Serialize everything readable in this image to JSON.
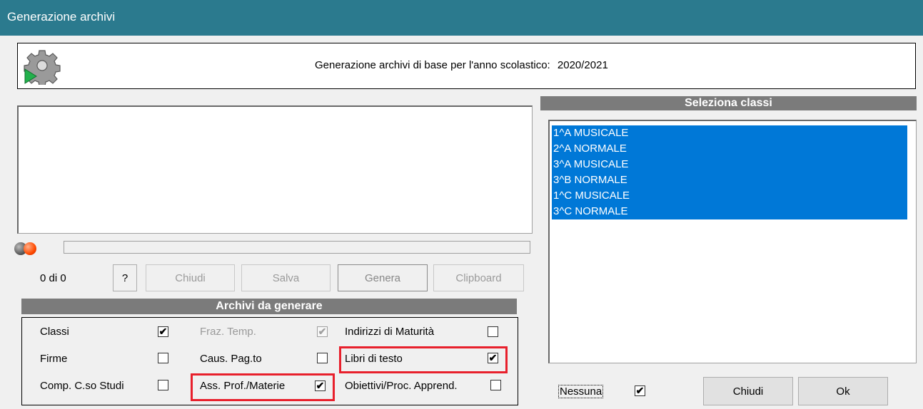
{
  "window": {
    "title": "Generazione archivi"
  },
  "header": {
    "icon": "gear-play-icon",
    "text": "Generazione archivi di base per l'anno scolastico:",
    "year": "2020/2021"
  },
  "progress": {
    "value": 0,
    "count_text": "0 di 0"
  },
  "buttons": {
    "help": "?",
    "chiudi": "Chiudi",
    "salva": "Salva",
    "genera": "Genera",
    "clipboard": "Clipboard"
  },
  "archivi": {
    "heading": "Archivi da generare",
    "items": [
      {
        "label": "Classi",
        "checked": true,
        "enabled": true
      },
      {
        "label": "Firme",
        "checked": false,
        "enabled": true
      },
      {
        "label": "Comp. C.so Studi",
        "checked": false,
        "enabled": true
      },
      {
        "label": "Fraz. Temp.",
        "checked": true,
        "enabled": false
      },
      {
        "label": "Caus. Pag.to",
        "checked": false,
        "enabled": true
      },
      {
        "label": "Ass. Prof./Materie",
        "checked": true,
        "enabled": true
      },
      {
        "label": "Indirizzi di Maturità",
        "checked": false,
        "enabled": true
      },
      {
        "label": "Libri di testo",
        "checked": true,
        "enabled": true
      },
      {
        "label": "Obiettivi/Proc. Apprend.",
        "checked": false,
        "enabled": true
      }
    ]
  },
  "classi": {
    "heading": "Seleziona classi",
    "items": [
      "1^A MUSICALE",
      "2^A NORMALE",
      "3^A MUSICALE",
      "3^B NORMALE",
      "1^C MUSICALE",
      "3^C NORMALE"
    ]
  },
  "footer": {
    "nessuna_label": "Nessuna",
    "nessuna_checked": true,
    "chiudi": "Chiudi",
    "ok": "Ok"
  },
  "colors": {
    "titlebar": "#2b7a8e",
    "selection": "#0078d7",
    "highlight": "#e8202c",
    "section": "#7b7b7b"
  }
}
